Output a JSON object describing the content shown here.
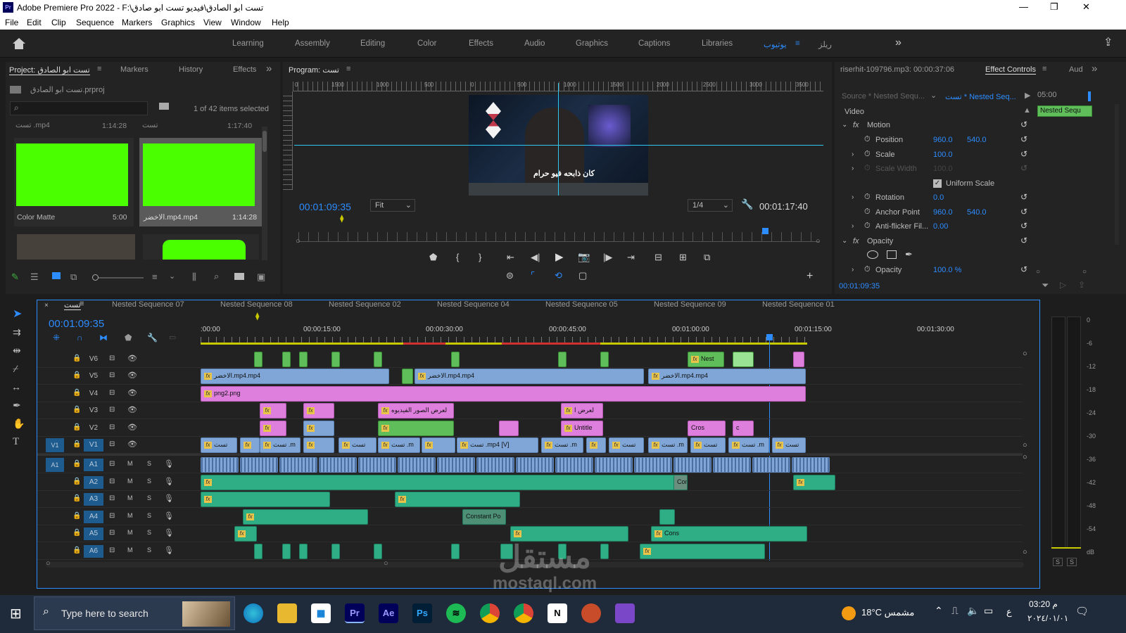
{
  "window": {
    "title": "Adobe Premiere Pro 2022 - F:\\تست ابو الصادق\\فيديو تست ابو صادق",
    "logo": "Pr",
    "minimize": "—",
    "maximize": "❐",
    "close": "✕"
  },
  "menu": [
    "File",
    "Edit",
    "Clip",
    "Sequence",
    "Markers",
    "Graphics",
    "View",
    "Window",
    "Help"
  ],
  "workspaces": [
    "Learning",
    "Assembly",
    "Editing",
    "Color",
    "Effects",
    "Audio",
    "Graphics",
    "Captions",
    "Libraries",
    "يوتيوب",
    "ريلز"
  ],
  "project": {
    "tabs": [
      "Project: تست ابو الصادق",
      "Markers",
      "History",
      "Effects"
    ],
    "file": "تست ابو الصادق.prproj",
    "search_placeholder": "",
    "selection": "1 of 42 items selected",
    "items": [
      {
        "name": "Color Matte",
        "dur": "5:00",
        "above_name": "تست .mp4",
        "above_dur": "1:14:28"
      },
      {
        "name": "الاخضر.mp4.mp4",
        "dur": "1:14:28",
        "above_name": "تست",
        "above_dur": "1:17:40"
      }
    ]
  },
  "program": {
    "title": "Program: تست",
    "ruler": [
      "0",
      "1500",
      "1000",
      "500",
      "0",
      "500",
      "1000",
      "1500",
      "2000",
      "2500",
      "3000",
      "3500"
    ],
    "timecode": "00:01:09:35",
    "fit": "Fit",
    "quality": "1/4",
    "duration": "00:01:17:40",
    "caption": "كان ذابحه فيو حرام"
  },
  "effects": {
    "source": "riserhit-109796.mp3: 00:00:37:06",
    "tab": "Effect Controls",
    "tab2": "Aud",
    "seq_source": "Source * Nested Sequ...",
    "seq_target": "تست * Nested Seq...",
    "time": "05:00",
    "clip_label": "Nested Sequ",
    "section": "Video",
    "rows": [
      {
        "label": "Motion",
        "v1": "",
        "v2": ""
      },
      {
        "label": "Position",
        "v1": "960.0",
        "v2": "540.0"
      },
      {
        "label": "Scale",
        "v1": "100.0",
        "v2": ""
      },
      {
        "label": "Scale Width",
        "v1": "100.0",
        "v2": ""
      },
      {
        "label": "Uniform Scale",
        "v1": "",
        "v2": ""
      },
      {
        "label": "Rotation",
        "v1": "0.0",
        "v2": ""
      },
      {
        "label": "Anchor Point",
        "v1": "960.0",
        "v2": "540.0"
      },
      {
        "label": "Anti-flicker Fil...",
        "v1": "0.00",
        "v2": ""
      },
      {
        "label": "Opacity",
        "v1": "",
        "v2": ""
      },
      {
        "label": "Opacity",
        "v1": "100.0 %",
        "v2": ""
      }
    ],
    "footer_time": "00:01:09:35"
  },
  "timeline": {
    "tabs": [
      "تست",
      "Nested Sequence 07",
      "Nested Sequence 08",
      "Nested Sequence 02",
      "Nested Sequence 04",
      "Nested Sequence 05",
      "Nested Sequence 09",
      "Nested Sequence 01"
    ],
    "timecode": "00:01:09:35",
    "ruler": [
      ":00:00",
      "00:00:15:00",
      "00:00:30:00",
      "00:00:45:00",
      "00:01:00:00",
      "00:01:15:00",
      "00:01:30:00"
    ],
    "video_tracks": [
      "V6",
      "V5",
      "V4",
      "V3",
      "V2",
      "V1"
    ],
    "audio_tracks": [
      "A1",
      "A2",
      "A3",
      "A4",
      "A5",
      "A6"
    ],
    "clip_labels": {
      "v6": "Nest",
      "v5a": "الاخضر.mp4.mp4",
      "v5b": "الاخضر.mp4.mp4",
      "v5c": "الاخضر.mp4.mp4",
      "v4": "png2.png",
      "v3a": "لعرض الصور الفيديوه",
      "v3b": "لعرض ا",
      "v2a": "Untitle",
      "v2b": "Cros",
      "v2c": "c",
      "v1a": "تست",
      "v1b": "تست .m",
      "v1c": "تست .mp4 [V]",
      "v1d": "تست .m",
      "v1e": "تست",
      "a2": "Cons",
      "a4": "Constant Po",
      "a5": "Cons"
    },
    "meter": [
      "0",
      "-6",
      "-12",
      "-18",
      "-24",
      "-30",
      "-36",
      "-42",
      "-48",
      "-54",
      "dB"
    ],
    "solo": [
      "S",
      "S"
    ]
  },
  "taskbar": {
    "search": "Type here to search",
    "weather": "18°C  مشمس",
    "time": "03:20 م",
    "date": "٢٠٢٤/٠١/٠١",
    "lang": "ع",
    "apps": [
      "Pr",
      "Ae",
      "Ps",
      "N"
    ]
  },
  "watermark": {
    "arabic": "مستقل",
    "latin": "mostaql.com"
  },
  "colors": {
    "accent": "#2d8cff",
    "video_clip": "#7fa6d6",
    "audio_clip": "#2fae86",
    "graphic_clip": "#de7fde",
    "green_clip": "#5fbd5a",
    "chroma": "#4aff00"
  }
}
